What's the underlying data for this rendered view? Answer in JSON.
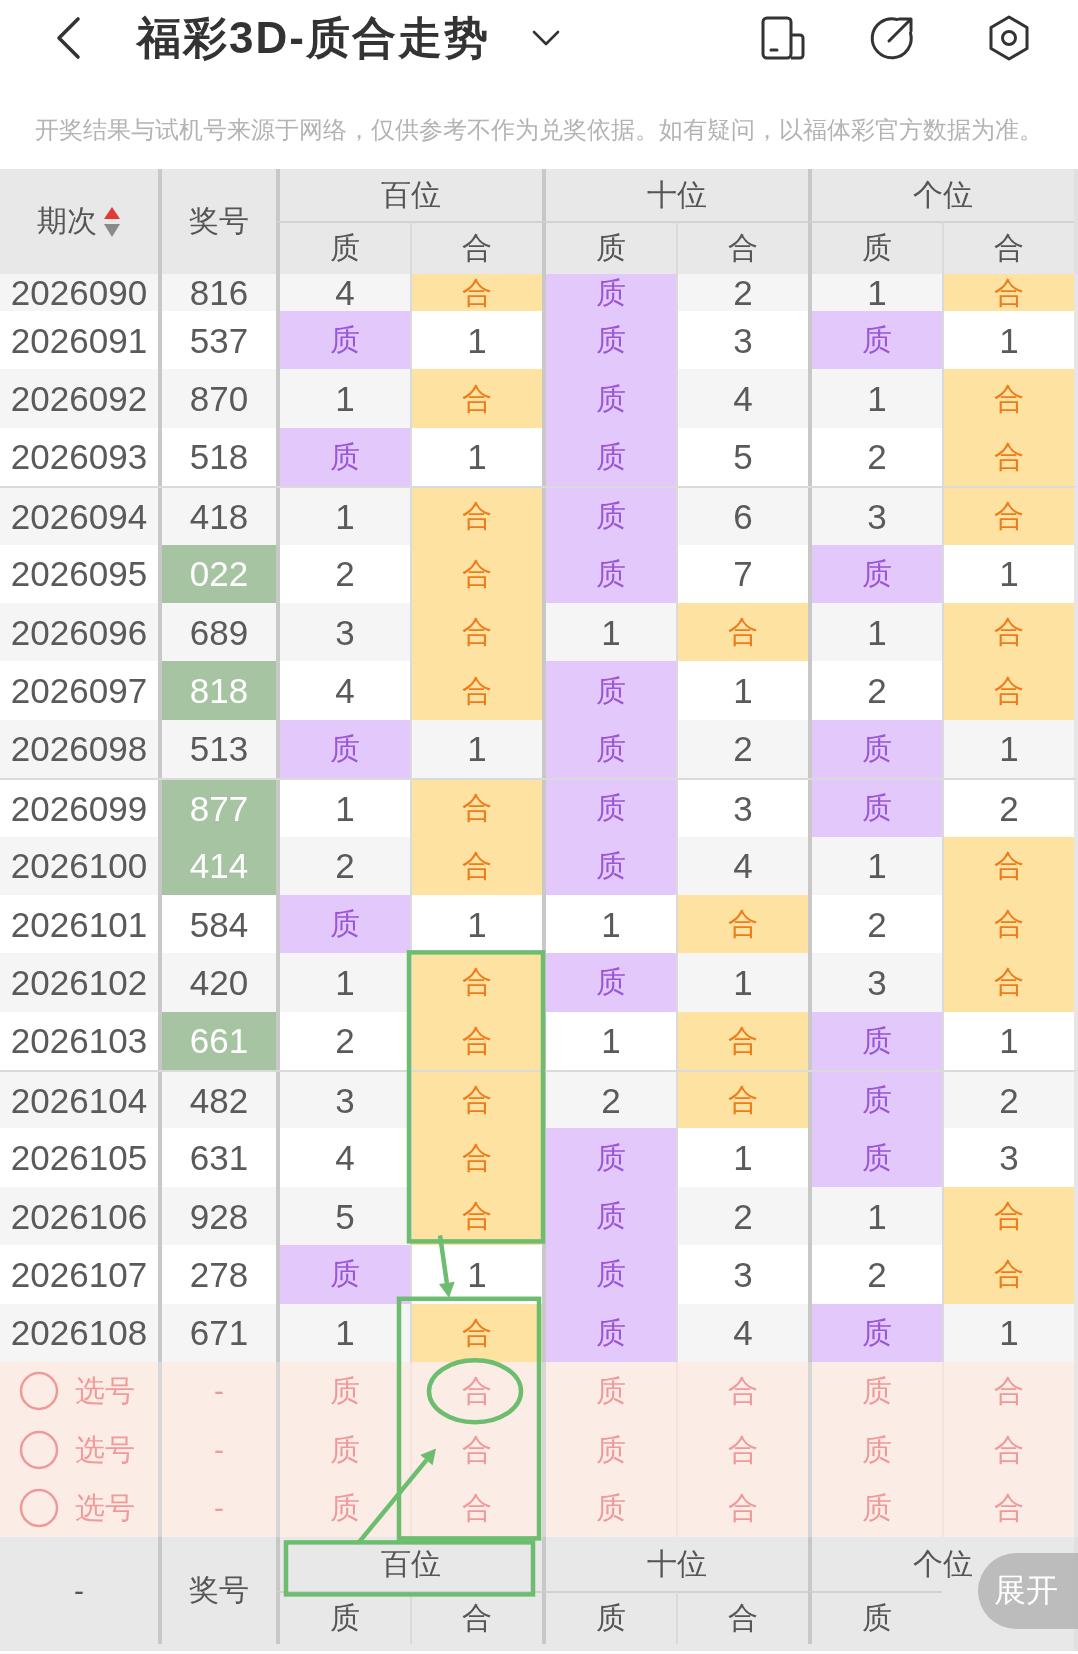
{
  "top_bar": {
    "title": "福彩3D-质合走势"
  },
  "notice": "开奖结果与试机号来源于网络，仅供参考不作为兑奖依据。如有疑问，以福体彩官方数据为准。",
  "table": {
    "header": {
      "issue": "期次",
      "sorted_ascending": true,
      "number": "奖号",
      "groups": [
        {
          "label": "百位",
          "subs": [
            {
              "label": "质",
              "kind": "prime"
            },
            {
              "label": "合",
              "kind": "composite"
            }
          ]
        },
        {
          "label": "十位",
          "subs": [
            {
              "label": "质",
              "kind": "prime"
            },
            {
              "label": "合",
              "kind": "composite"
            }
          ]
        },
        {
          "label": "个位",
          "subs": [
            {
              "label": "质",
              "kind": "prime"
            },
            {
              "label": "合",
              "kind": "composite"
            }
          ]
        }
      ]
    },
    "rows": [
      {
        "issue": "2026090",
        "number": "816",
        "highlighted": false,
        "cells": [
          {
            "text": "4",
            "hit": false
          },
          {
            "text": "合",
            "hit": true
          },
          {
            "text": "质",
            "hit": true
          },
          {
            "text": "2",
            "hit": false
          },
          {
            "text": "1",
            "hit": false
          },
          {
            "text": "合",
            "hit": true
          }
        ]
      },
      {
        "issue": "2026091",
        "number": "537",
        "highlighted": false,
        "cells": [
          {
            "text": "质",
            "hit": true
          },
          {
            "text": "1",
            "hit": false
          },
          {
            "text": "质",
            "hit": true
          },
          {
            "text": "3",
            "hit": false
          },
          {
            "text": "质",
            "hit": true
          },
          {
            "text": "1",
            "hit": false
          }
        ]
      },
      {
        "issue": "2026092",
        "number": "870",
        "highlighted": false,
        "cells": [
          {
            "text": "1",
            "hit": false
          },
          {
            "text": "合",
            "hit": true
          },
          {
            "text": "质",
            "hit": true
          },
          {
            "text": "4",
            "hit": false
          },
          {
            "text": "1",
            "hit": false
          },
          {
            "text": "合",
            "hit": true
          }
        ]
      },
      {
        "issue": "2026093",
        "number": "518",
        "highlighted": false,
        "cells": [
          {
            "text": "质",
            "hit": true
          },
          {
            "text": "1",
            "hit": false
          },
          {
            "text": "质",
            "hit": true
          },
          {
            "text": "5",
            "hit": false
          },
          {
            "text": "2",
            "hit": false
          },
          {
            "text": "合",
            "hit": true
          }
        ]
      },
      {
        "issue": "2026094",
        "number": "418",
        "highlighted": false,
        "cells": [
          {
            "text": "1",
            "hit": false
          },
          {
            "text": "合",
            "hit": true
          },
          {
            "text": "质",
            "hit": true
          },
          {
            "text": "6",
            "hit": false
          },
          {
            "text": "3",
            "hit": false
          },
          {
            "text": "合",
            "hit": true
          }
        ]
      },
      {
        "issue": "2026095",
        "number": "022",
        "highlighted": true,
        "cells": [
          {
            "text": "2",
            "hit": false
          },
          {
            "text": "合",
            "hit": true
          },
          {
            "text": "质",
            "hit": true
          },
          {
            "text": "7",
            "hit": false
          },
          {
            "text": "质",
            "hit": true
          },
          {
            "text": "1",
            "hit": false
          }
        ]
      },
      {
        "issue": "2026096",
        "number": "689",
        "highlighted": false,
        "cells": [
          {
            "text": "3",
            "hit": false
          },
          {
            "text": "合",
            "hit": true
          },
          {
            "text": "1",
            "hit": false
          },
          {
            "text": "合",
            "hit": true
          },
          {
            "text": "1",
            "hit": false
          },
          {
            "text": "合",
            "hit": true
          }
        ]
      },
      {
        "issue": "2026097",
        "number": "818",
        "highlighted": true,
        "cells": [
          {
            "text": "4",
            "hit": false
          },
          {
            "text": "合",
            "hit": true
          },
          {
            "text": "质",
            "hit": true
          },
          {
            "text": "1",
            "hit": false
          },
          {
            "text": "2",
            "hit": false
          },
          {
            "text": "合",
            "hit": true
          }
        ]
      },
      {
        "issue": "2026098",
        "number": "513",
        "highlighted": false,
        "cells": [
          {
            "text": "质",
            "hit": true
          },
          {
            "text": "1",
            "hit": false
          },
          {
            "text": "质",
            "hit": true
          },
          {
            "text": "2",
            "hit": false
          },
          {
            "text": "质",
            "hit": true
          },
          {
            "text": "1",
            "hit": false
          }
        ]
      },
      {
        "issue": "2026099",
        "number": "877",
        "highlighted": true,
        "cells": [
          {
            "text": "1",
            "hit": false
          },
          {
            "text": "合",
            "hit": true
          },
          {
            "text": "质",
            "hit": true
          },
          {
            "text": "3",
            "hit": false
          },
          {
            "text": "质",
            "hit": true
          },
          {
            "text": "2",
            "hit": false
          }
        ]
      },
      {
        "issue": "2026100",
        "number": "414",
        "highlighted": true,
        "cells": [
          {
            "text": "2",
            "hit": false
          },
          {
            "text": "合",
            "hit": true
          },
          {
            "text": "质",
            "hit": true
          },
          {
            "text": "4",
            "hit": false
          },
          {
            "text": "1",
            "hit": false
          },
          {
            "text": "合",
            "hit": true
          }
        ]
      },
      {
        "issue": "2026101",
        "number": "584",
        "highlighted": false,
        "cells": [
          {
            "text": "质",
            "hit": true
          },
          {
            "text": "1",
            "hit": false
          },
          {
            "text": "1",
            "hit": false
          },
          {
            "text": "合",
            "hit": true
          },
          {
            "text": "2",
            "hit": false
          },
          {
            "text": "合",
            "hit": true
          }
        ]
      },
      {
        "issue": "2026102",
        "number": "420",
        "highlighted": false,
        "cells": [
          {
            "text": "1",
            "hit": false
          },
          {
            "text": "合",
            "hit": true
          },
          {
            "text": "质",
            "hit": true
          },
          {
            "text": "1",
            "hit": false
          },
          {
            "text": "3",
            "hit": false
          },
          {
            "text": "合",
            "hit": true
          }
        ]
      },
      {
        "issue": "2026103",
        "number": "661",
        "highlighted": true,
        "cells": [
          {
            "text": "2",
            "hit": false
          },
          {
            "text": "合",
            "hit": true
          },
          {
            "text": "1",
            "hit": false
          },
          {
            "text": "合",
            "hit": true
          },
          {
            "text": "质",
            "hit": true
          },
          {
            "text": "1",
            "hit": false
          }
        ]
      },
      {
        "issue": "2026104",
        "number": "482",
        "highlighted": false,
        "cells": [
          {
            "text": "3",
            "hit": false
          },
          {
            "text": "合",
            "hit": true
          },
          {
            "text": "2",
            "hit": false
          },
          {
            "text": "合",
            "hit": true
          },
          {
            "text": "质",
            "hit": true
          },
          {
            "text": "2",
            "hit": false
          }
        ]
      },
      {
        "issue": "2026105",
        "number": "631",
        "highlighted": false,
        "cells": [
          {
            "text": "4",
            "hit": false
          },
          {
            "text": "合",
            "hit": true
          },
          {
            "text": "质",
            "hit": true
          },
          {
            "text": "1",
            "hit": false
          },
          {
            "text": "质",
            "hit": true
          },
          {
            "text": "3",
            "hit": false
          }
        ]
      },
      {
        "issue": "2026106",
        "number": "928",
        "highlighted": false,
        "cells": [
          {
            "text": "5",
            "hit": false
          },
          {
            "text": "合",
            "hit": true
          },
          {
            "text": "质",
            "hit": true
          },
          {
            "text": "2",
            "hit": false
          },
          {
            "text": "1",
            "hit": false
          },
          {
            "text": "合",
            "hit": true
          }
        ]
      },
      {
        "issue": "2026107",
        "number": "278",
        "highlighted": false,
        "cells": [
          {
            "text": "质",
            "hit": true
          },
          {
            "text": "1",
            "hit": false
          },
          {
            "text": "质",
            "hit": true
          },
          {
            "text": "3",
            "hit": false
          },
          {
            "text": "2",
            "hit": false
          },
          {
            "text": "合",
            "hit": true
          }
        ]
      },
      {
        "issue": "2026108",
        "number": "671",
        "highlighted": false,
        "cells": [
          {
            "text": "1",
            "hit": false
          },
          {
            "text": "合",
            "hit": true
          },
          {
            "text": "质",
            "hit": true
          },
          {
            "text": "4",
            "hit": false
          },
          {
            "text": "质",
            "hit": true
          },
          {
            "text": "1",
            "hit": false
          }
        ]
      }
    ],
    "pick_rows": [
      {
        "checked": false,
        "label": "选号",
        "number": "-",
        "cells": [
          "质",
          "合",
          "质",
          "合",
          "质",
          "合"
        ]
      },
      {
        "checked": false,
        "label": "选号",
        "number": "-",
        "cells": [
          "质",
          "合",
          "质",
          "合",
          "质",
          "合"
        ]
      },
      {
        "checked": false,
        "label": "选号",
        "number": "-",
        "cells": [
          "质",
          "合",
          "质",
          "合",
          "质",
          "合"
        ]
      }
    ],
    "footer": {
      "issue": "-",
      "number": "奖号",
      "groups": [
        {
          "label": "百位",
          "subs": [
            "质",
            "合"
          ]
        },
        {
          "label": "十位",
          "subs": [
            "质",
            "合"
          ]
        },
        {
          "label": "个位",
          "subs": [
            "质"
          ]
        }
      ]
    }
  },
  "expand_button": "展开"
}
